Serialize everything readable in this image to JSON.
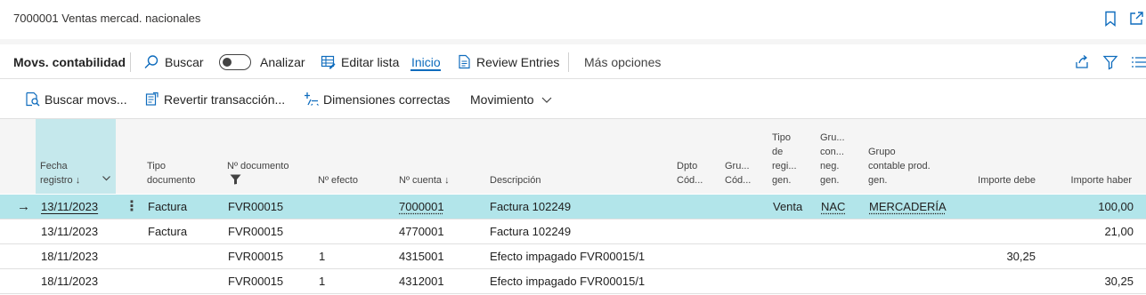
{
  "window": {
    "title": "7000001 Ventas mercad. nacionales"
  },
  "actionbar": {
    "page_caption": "Movs. contabilidad",
    "search_label": "Buscar",
    "analyze_label": "Analizar",
    "edit_list_label": "Editar lista",
    "home_label": "Inicio",
    "review_entries_label": "Review Entries",
    "more_options_label": "Más opciones"
  },
  "subbar": {
    "find_entries_label": "Buscar movs...",
    "reverse_label": "Revertir transacción...",
    "dimensions_label": "Dimensiones correctas",
    "movement_label": "Movimiento"
  },
  "columns": {
    "fecha_l1": "Fecha",
    "fecha_l2": "registro ↓",
    "tipo_l1": "Tipo",
    "tipo_l2": "documento",
    "ndoc_l1": "Nº documento",
    "nefecto": "Nº efecto",
    "ncuenta": "Nº cuenta ↓",
    "descripcion": "Descripción",
    "dpto_l1": "Dpto",
    "dpto_l2": "Cód...",
    "gru_l1": "Gru...",
    "gru_l2": "Cód...",
    "tiporeg_l1": "Tipo",
    "tiporeg_l2": "de",
    "tiporeg_l3": "regi...",
    "tiporeg_l4": "gen.",
    "grucon_l1": "Gru...",
    "grucon_l2": "con...",
    "grucon_l3": "neg.",
    "grucon_l4": "gen.",
    "grupo_l1": "Grupo",
    "grupo_l2": "contable prod.",
    "grupo_l3": "gen.",
    "debe": "Importe debe",
    "haber": "Importe haber"
  },
  "rows": [
    {
      "fecha": "13/11/2023",
      "tipo": "Factura",
      "ndoc": "FVR00015",
      "nefecto": "",
      "ncuenta": "7000001",
      "descripcion": "Factura 102249",
      "tiporeg": "Venta",
      "grucon": "NAC",
      "grupo": "MERCADERÍA",
      "debe": "",
      "haber": "100,00"
    },
    {
      "fecha": "13/11/2023",
      "tipo": "Factura",
      "ndoc": "FVR00015",
      "nefecto": "",
      "ncuenta": "4770001",
      "descripcion": "Factura 102249",
      "tiporeg": "",
      "grucon": "",
      "grupo": "",
      "debe": "",
      "haber": "21,00"
    },
    {
      "fecha": "18/11/2023",
      "tipo": "",
      "ndoc": "FVR00015",
      "nefecto": "1",
      "ncuenta": "4315001",
      "descripcion": "Efecto impagado FVR00015/1",
      "tiporeg": "",
      "grucon": "",
      "grupo": "",
      "debe": "30,25",
      "haber": ""
    },
    {
      "fecha": "18/11/2023",
      "tipo": "",
      "ndoc": "FVR00015",
      "nefecto": "1",
      "ncuenta": "4312001",
      "descripcion": "Efecto impagado FVR00015/1",
      "tiporeg": "",
      "grucon": "",
      "grupo": "",
      "debe": "",
      "haber": "30,25"
    }
  ],
  "theme": {
    "accent": "#0f6cbd",
    "selected_row": "#b2e5ea",
    "sorted_header": "#c5e8ec"
  }
}
